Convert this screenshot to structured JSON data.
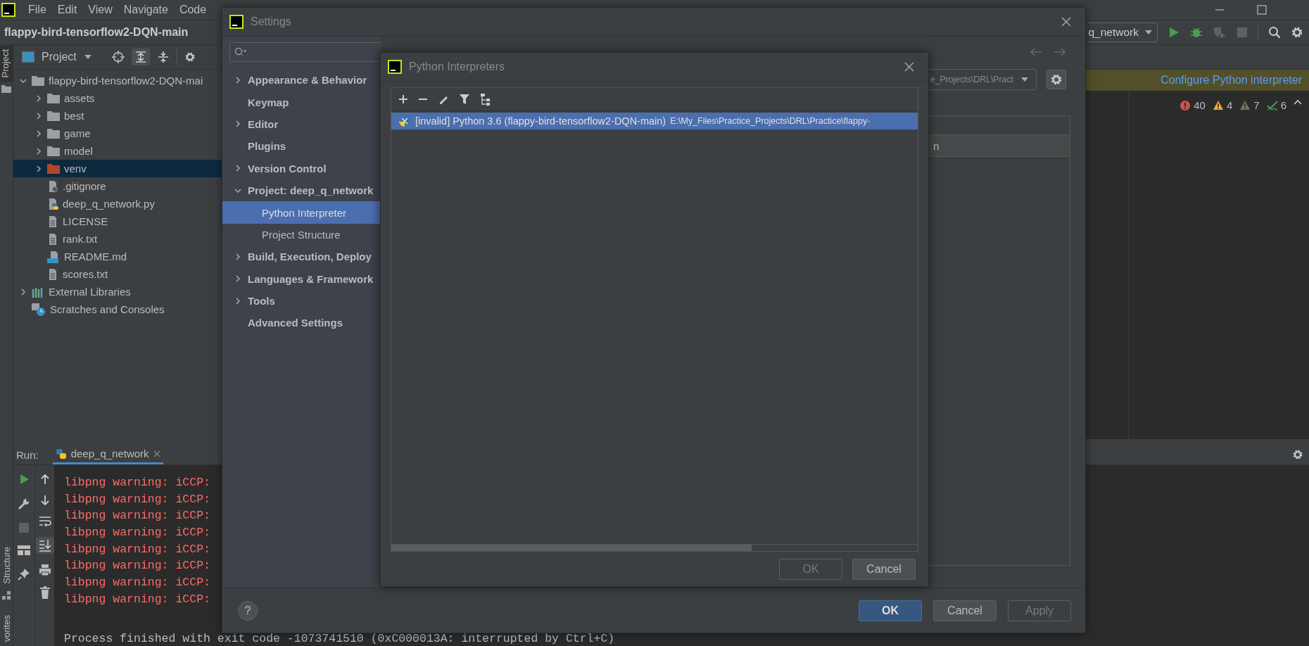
{
  "menu": [
    "File",
    "Edit",
    "View",
    "Navigate",
    "Code"
  ],
  "breadcrumb": "flappy-bird-tensorflow2-DQN-main",
  "left_stripe": {
    "top": [
      {
        "label": "Project",
        "selected": true
      }
    ],
    "bottom": [
      {
        "label": "Structure",
        "selected": false
      },
      {
        "label": "vorites",
        "selected": false
      }
    ]
  },
  "project_panel": {
    "title": "Project",
    "tree": [
      {
        "label": "flappy-bird-tensorflow2-DQN-mai",
        "kind": "folder",
        "expanded": true,
        "selected": false,
        "children": [
          {
            "label": "assets",
            "kind": "folder",
            "expanded": false,
            "selected": false
          },
          {
            "label": "best",
            "kind": "folder",
            "expanded": false,
            "selected": false
          },
          {
            "label": "game",
            "kind": "folder",
            "expanded": false,
            "selected": false
          },
          {
            "label": "model",
            "kind": "folder",
            "expanded": false,
            "selected": false
          },
          {
            "label": "venv",
            "kind": "venv",
            "expanded": false,
            "selected": true
          },
          {
            "label": ".gitignore",
            "kind": "ignore",
            "selected": false
          },
          {
            "label": "deep_q_network.py",
            "kind": "python",
            "selected": false
          },
          {
            "label": "LICENSE",
            "kind": "text",
            "selected": false
          },
          {
            "label": "rank.txt",
            "kind": "text",
            "selected": false
          },
          {
            "label": "README.md",
            "kind": "markdown",
            "selected": false
          },
          {
            "label": "scores.txt",
            "kind": "text",
            "selected": false
          }
        ]
      },
      {
        "label": "External Libraries",
        "kind": "libraries",
        "expanded": false,
        "selected": false
      },
      {
        "label": "Scratches and Consoles",
        "kind": "scratches",
        "selected": false
      }
    ]
  },
  "editor": {
    "run_config": "q_network",
    "banner": "Configure Python interpreter",
    "inspections": [
      {
        "kind": "error",
        "count": "40"
      },
      {
        "kind": "warning",
        "count": "4"
      },
      {
        "kind": "weak_warning",
        "count": "7"
      },
      {
        "kind": "typo",
        "count": "6"
      }
    ]
  },
  "run_panel": {
    "label": "Run:",
    "tab": "deep_q_network",
    "lines": [
      "libpng warning: iCCP:",
      "libpng warning: iCCP:",
      "libpng warning: iCCP:",
      "libpng warning: iCCP:",
      "libpng warning: iCCP:",
      "libpng warning: iCCP:",
      "libpng warning: iCCP:",
      "libpng warning: iCCP:"
    ],
    "exit_line": "Process finished with exit code -1073741510 (0xC000013A: interrupted by Ctrl+C)"
  },
  "settings": {
    "title": "Settings",
    "nav": [
      {
        "label": "Appearance & Behavior",
        "expanded": false,
        "selected": false
      },
      {
        "label": "Keymap",
        "selected": false
      },
      {
        "label": "Editor",
        "expanded": false,
        "selected": false
      },
      {
        "label": "Plugins",
        "selected": false
      },
      {
        "label": "Version Control",
        "expanded": false,
        "selected": false
      },
      {
        "label": "Project: deep_q_network",
        "expanded": true,
        "selected": false,
        "children": [
          {
            "label": "Python Interpreter",
            "selected": true
          },
          {
            "label": "Project Structure",
            "selected": false
          }
        ]
      },
      {
        "label": "Build, Execution, Deploy",
        "expanded": false,
        "selected": false
      },
      {
        "label": "Languages & Framework",
        "expanded": false,
        "selected": false
      },
      {
        "label": "Tools",
        "expanded": false,
        "selected": false
      },
      {
        "label": "Advanced Settings",
        "selected": false
      }
    ],
    "interpreter_value": "e_Projects\\DRL\\Pract",
    "table_header": "n",
    "help": "?",
    "buttons": [
      {
        "label": "OK",
        "kind": "primary"
      },
      {
        "label": "Cancel",
        "kind": "normal"
      },
      {
        "label": "Apply",
        "kind": "disabled"
      }
    ]
  },
  "interpreters_dialog": {
    "title": "Python Interpreters",
    "rows": [
      {
        "status": "[invalid]",
        "name": "Python 3.6 (flappy-bird-tensorflow2-DQN-main)",
        "path": "E:\\My_Files\\Practice_Projects\\DRL\\Practice\\flappy-",
        "selected": true
      }
    ],
    "buttons": [
      {
        "label": "OK",
        "disabled": true
      },
      {
        "label": "Cancel",
        "disabled": false
      }
    ]
  }
}
